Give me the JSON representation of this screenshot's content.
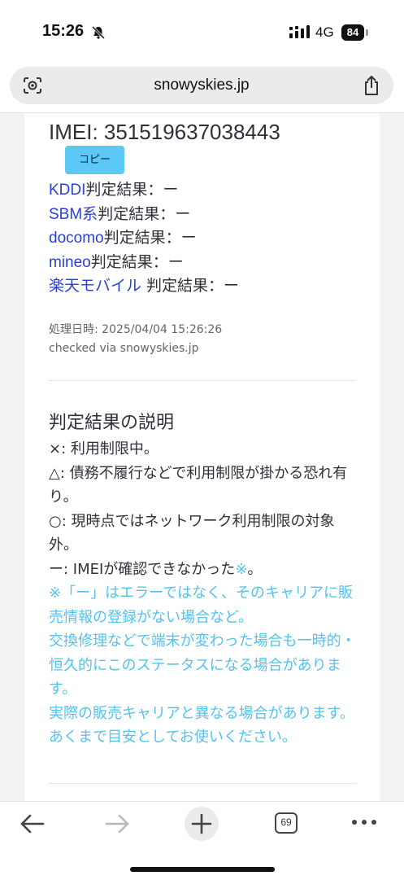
{
  "status_bar": {
    "time": "15:26",
    "network": "4G",
    "battery": "84"
  },
  "browser": {
    "url": "snowyskies.jp"
  },
  "imei": {
    "text": "IMEI: 351519637038443",
    "copy_label": "コピー"
  },
  "results": [
    {
      "carrier": "KDDI",
      "suffix": "判定結果：ー"
    },
    {
      "carrier": "SBM系",
      "suffix": "判定結果：ー"
    },
    {
      "carrier": "docomo",
      "suffix": "判定結果：ー"
    },
    {
      "carrier": "mineo",
      "suffix": "判定結果：ー"
    },
    {
      "carrier": "楽天モバイル",
      "suffix": " 判定結果：ー"
    }
  ],
  "meta": {
    "processed": "処理日時: 2025/04/04 15:26:26",
    "checked": "checked via snowyskies.jp"
  },
  "legend": {
    "title": "判定結果の説明",
    "lines": [
      "×: 利用制限中。",
      "△: 債務不履行などで利用制限が掛かる恐れ有り。",
      "○: 現時点ではネットワーク利用制限の対象外。"
    ],
    "dash_line": "ー: IMEIが確認できなかった",
    "dash_mark": "※",
    "dash_end": "。",
    "notes": [
      "※「ー」はエラーではなく、そのキャリアに販売情報の登録がない場合など。",
      "交換修理などで端末が変わった場合も一時的・恒久的にこのステータスになる場合があります。",
      "実際の販売キャリアと異なる場合があります。あくまで目安としてお使いください。"
    ]
  },
  "toolbar": {
    "tab_count": "69"
  },
  "colors": {
    "link": "#2b40d6",
    "accent_cyan": "#54c2ee",
    "button": "#5bc8f5"
  }
}
